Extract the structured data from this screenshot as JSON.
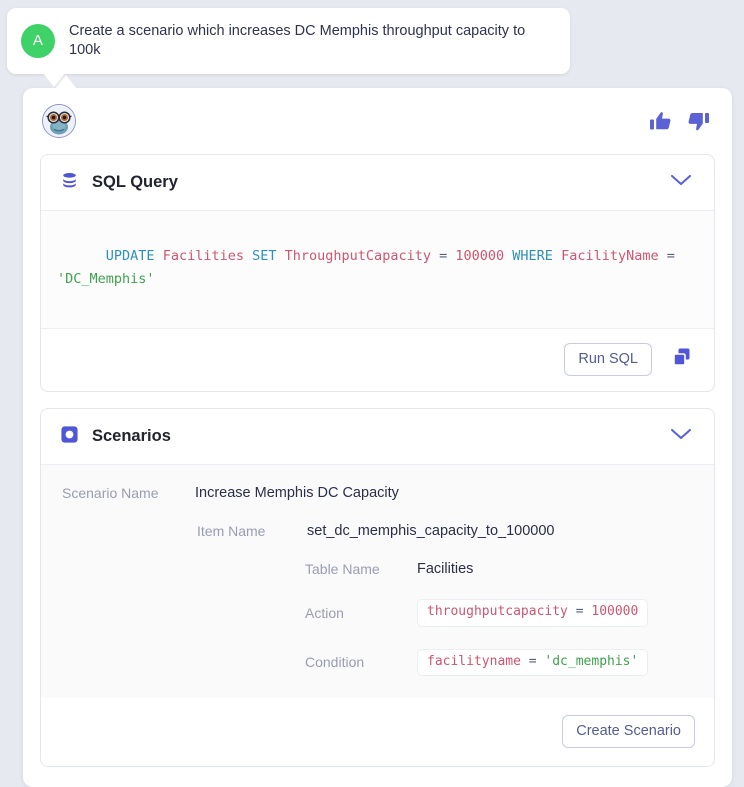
{
  "conversation": {
    "user": {
      "avatar_initial": "A",
      "avatar_color": "#3ed268",
      "message": "Create a scenario which increases DC Memphis throughput capacity to 100k"
    },
    "assistant": {
      "avatar_icon": "bot-frog-glasses-avatar",
      "feedback": {
        "thumbs_up_icon": "thumbs-up-icon",
        "thumbs_down_icon": "thumbs-down-icon",
        "color": "#5b62d6"
      }
    }
  },
  "sql_panel": {
    "icon": "database-icon",
    "icon_color": "#4f57d8",
    "title": "SQL Query",
    "collapse_icon": "chevron-down-icon",
    "query_tokens": [
      {
        "t": "UPDATE",
        "c": "kw"
      },
      {
        "t": " ",
        "c": "op"
      },
      {
        "t": "Facilities",
        "c": "id"
      },
      {
        "t": " ",
        "c": "op"
      },
      {
        "t": "SET",
        "c": "kw"
      },
      {
        "t": " ",
        "c": "op"
      },
      {
        "t": "ThroughputCapacity",
        "c": "id"
      },
      {
        "t": " = ",
        "c": "op"
      },
      {
        "t": "100000",
        "c": "num"
      },
      {
        "t": " ",
        "c": "op"
      },
      {
        "t": "WHERE",
        "c": "kw"
      },
      {
        "t": " ",
        "c": "op"
      },
      {
        "t": "FacilityName",
        "c": "id"
      },
      {
        "t": " = ",
        "c": "op"
      },
      {
        "t": "'DC_Memphis'",
        "c": "str"
      }
    ],
    "query_plain": "UPDATE Facilities SET ThroughputCapacity = 100000 WHERE FacilityName = 'DC_Memphis'",
    "run_button_label": "Run SQL",
    "copy_icon": "copy-icon"
  },
  "scenarios_panel": {
    "icon": "scenario-square-icon",
    "icon_color": "#4f57d8",
    "title": "Scenarios",
    "collapse_icon": "chevron-down-icon",
    "fields": {
      "scenario_name_label": "Scenario Name",
      "scenario_name_value": "Increase Memphis DC Capacity",
      "item_name_label": "Item Name",
      "item_name_value": "set_dc_memphis_capacity_to_100000",
      "table_name_label": "Table Name",
      "table_name_value": "Facilities",
      "action_label": "Action",
      "action_tokens": [
        {
          "t": "throughputcapacity",
          "c": "id"
        },
        {
          "t": " = ",
          "c": "op"
        },
        {
          "t": "100000",
          "c": "num"
        }
      ],
      "action_value": "throughputcapacity = 100000",
      "condition_label": "Condition",
      "condition_tokens": [
        {
          "t": "facilityname",
          "c": "id"
        },
        {
          "t": " = ",
          "c": "op"
        },
        {
          "t": "'dc_memphis'",
          "c": "str"
        }
      ],
      "condition_value": "facilityname = 'dc_memphis'"
    },
    "create_button_label": "Create Scenario"
  }
}
